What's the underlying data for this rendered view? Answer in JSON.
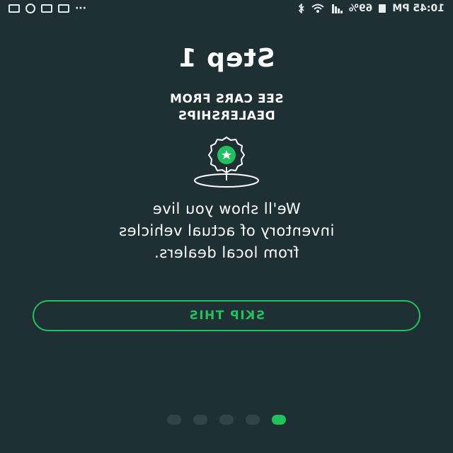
{
  "status_bar": {
    "time": "10:45 PM",
    "battery": "69%",
    "overflow": "···"
  },
  "onboarding": {
    "step_title": "Step 1",
    "subtitle_lines": [
      "SEE CARS FROM",
      "DEALERSHIPS"
    ],
    "description_lines": [
      "We'll show you live",
      "inventory of actual vehicles",
      "from local dealers."
    ],
    "skip_label": "SKIP THIS",
    "pager": {
      "total": 5,
      "current": 1
    }
  },
  "colors": {
    "background": "#1f3034",
    "accent": "#22c05e",
    "dot_inactive": "#334448",
    "text": "#ffffff"
  },
  "icons": {
    "badge": "dealership-star-badge-icon"
  }
}
